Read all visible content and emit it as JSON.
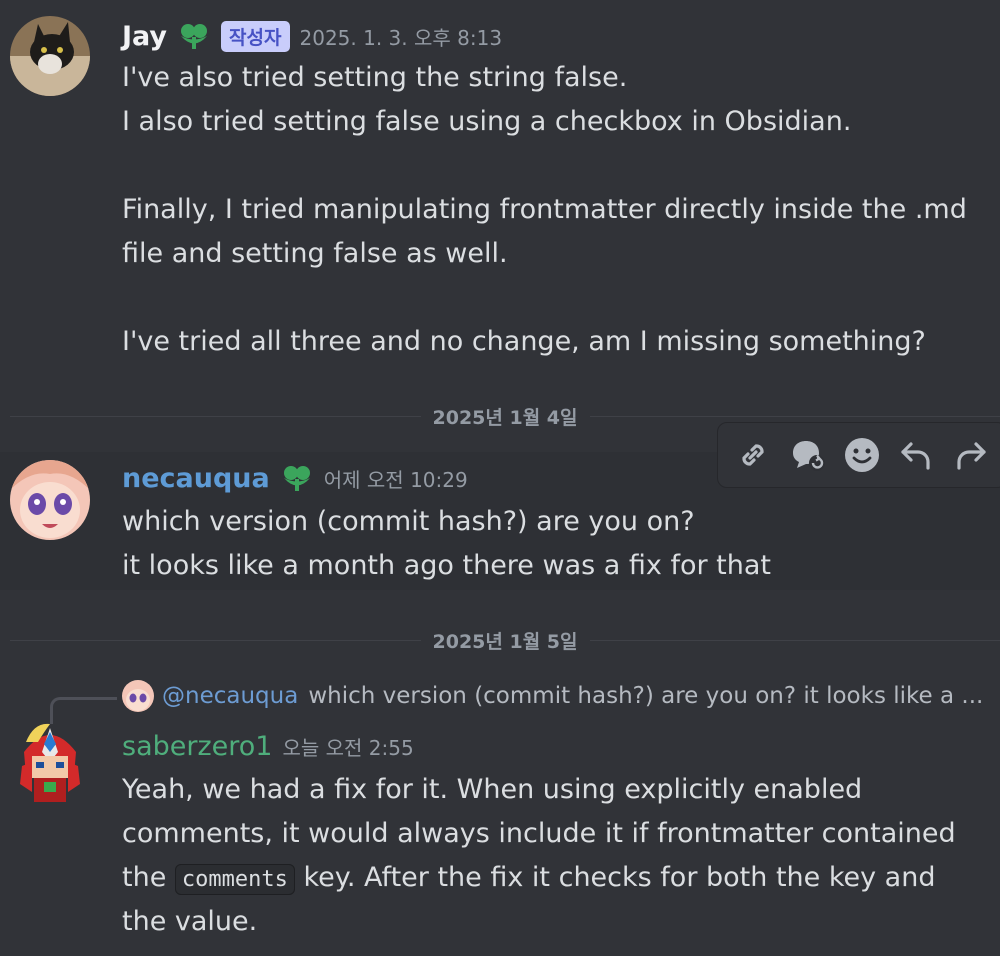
{
  "messages": [
    {
      "author": "Jay",
      "author_color": "#f2f3f5",
      "role_tag": "작성자",
      "timestamp": "2025. 1. 3. 오후 8:13",
      "lines": [
        "I've also tried setting the string false.",
        "I also tried setting false using a checkbox in Obsidian.",
        "",
        "Finally, I tried manipulating frontmatter directly inside the .md",
        "file and setting false as well.",
        "",
        "I've tried all three and no change, am I missing something?"
      ]
    },
    {
      "author": "necauqua",
      "author_color": "#5e9bd6",
      "timestamp": "어제 오전 10:29",
      "lines": [
        "which version (commit hash?) are you on?",
        "it looks like a month ago there was a fix for that"
      ]
    },
    {
      "author": "saberzero1",
      "author_color": "#4fae7c",
      "timestamp": "오늘 오전 2:55",
      "reply": {
        "mention": "@necauqua",
        "snippet": "which version (commit hash?) are you on? it looks like a ..."
      },
      "lines": [
        "Yeah, we had a fix for it. When using explicitly enabled",
        "comments, it would always include it if frontmatter contained"
      ],
      "line3_before": "the",
      "line3_code": "comments",
      "line3_after": "key. After the fix it checks for both the key and",
      "line4": "the value."
    }
  ],
  "dividers": [
    "2025년 1월 4일",
    "2025년 1월 5일"
  ],
  "toolbar_icons": [
    "link-icon",
    "thread-icon",
    "emoji-icon",
    "reply-icon",
    "forward-icon"
  ],
  "colors": {
    "badge_green": "#3ba55c",
    "bg": "#313338"
  }
}
